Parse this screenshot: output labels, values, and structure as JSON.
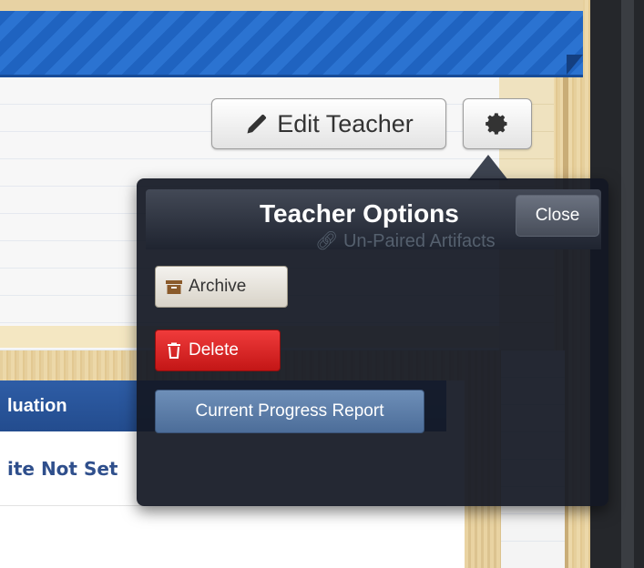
{
  "header": {
    "edit_label": "Edit Teacher",
    "edit_icon": "pencil-icon",
    "settings_icon": "gear-icon"
  },
  "table": {
    "column_header": "luation",
    "status_value": "ite Not Set"
  },
  "popover": {
    "title": "Teacher Options",
    "close_label": "Close",
    "background_link": "Un-Paired Artifacts",
    "actions": {
      "archive": "Archive",
      "delete": "Delete",
      "progress": "Current Progress Report"
    }
  },
  "colors": {
    "brand_blue": "#1f63c0",
    "delete_red": "#d62020",
    "popover_bg": "#131824"
  }
}
